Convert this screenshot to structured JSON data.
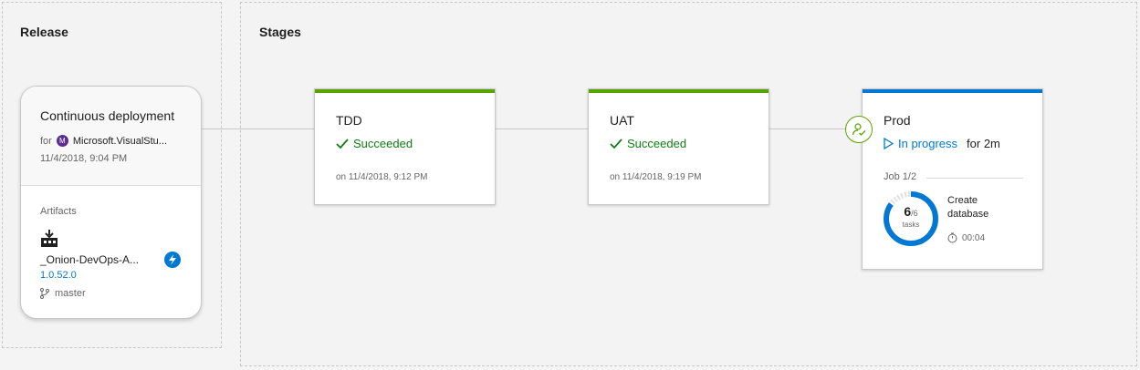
{
  "release": {
    "section_title": "Release",
    "card": {
      "title": "Continuous deployment",
      "for_label": "for",
      "project_initial": "M",
      "project_name": "Microsoft.VisualStu...",
      "date": "11/4/2018, 9:04 PM",
      "artifacts_label": "Artifacts",
      "artifact_name": "_Onion-DevOps-A...",
      "artifact_version": "1.0.52.0",
      "branch": "master"
    }
  },
  "stages": {
    "section_title": "Stages",
    "items": [
      {
        "name": "TDD",
        "status": "Succeeded",
        "time": "on 11/4/2018, 9:12 PM",
        "status_color": "#107c10",
        "bar_color": "#57a300"
      },
      {
        "name": "UAT",
        "status": "Succeeded",
        "time": "on 11/4/2018, 9:19 PM",
        "status_color": "#107c10",
        "bar_color": "#57a300"
      },
      {
        "name": "Prod",
        "status": "In progress",
        "duration": "for 2m",
        "status_color": "#0078d4",
        "bar_color": "#0078d4",
        "job_label": "Job 1/2",
        "tasks_done": "6",
        "tasks_total": "/6",
        "tasks_unit": "tasks",
        "tasks_progress": 0.85,
        "task_name": "Create database",
        "task_elapsed": "00:04"
      }
    ]
  },
  "colors": {
    "success": "#57a300",
    "accent": "#0078d4",
    "release_avatar": "#5c2d91"
  }
}
